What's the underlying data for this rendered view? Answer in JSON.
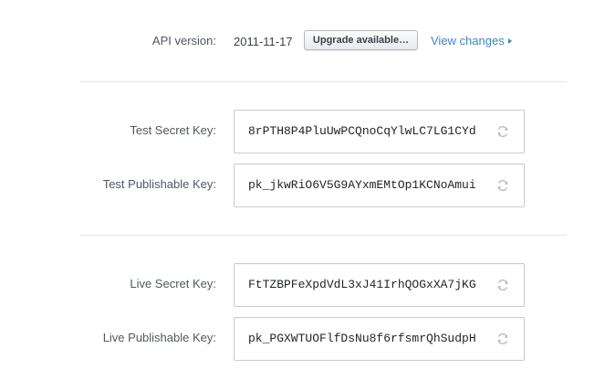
{
  "api": {
    "label": "API version:",
    "version": "2011-11-17",
    "upgrade_label": "Upgrade available…",
    "view_changes_label": "View changes"
  },
  "keys": {
    "test_secret": {
      "label": "Test Secret Key:",
      "value": "8rPTH8P4PluUwPCQnoCqYlwLC7LG1CYd"
    },
    "test_publishable": {
      "label": "Test Publishable Key:",
      "value": "pk_jkwRiO6V5G9AYxmEMtOp1KCNoAmui"
    },
    "live_secret": {
      "label": "Live Secret Key:",
      "value": "FtTZBPFeXpdVdL3xJ41IrhQOGxXA7jKG"
    },
    "live_publishable": {
      "label": "Live Publishable Key:",
      "value": "pk_PGXWTUOFlfDsNu8f6rfsmrQhSudpH"
    }
  },
  "icons": {
    "roll_key": "refresh-icon",
    "view_changes": "caret-right-icon"
  },
  "colors": {
    "link": "#3a87c8",
    "divider": "#e4e6e9",
    "field_border": "#c9ccd1",
    "icon": "#b9bdc2"
  }
}
